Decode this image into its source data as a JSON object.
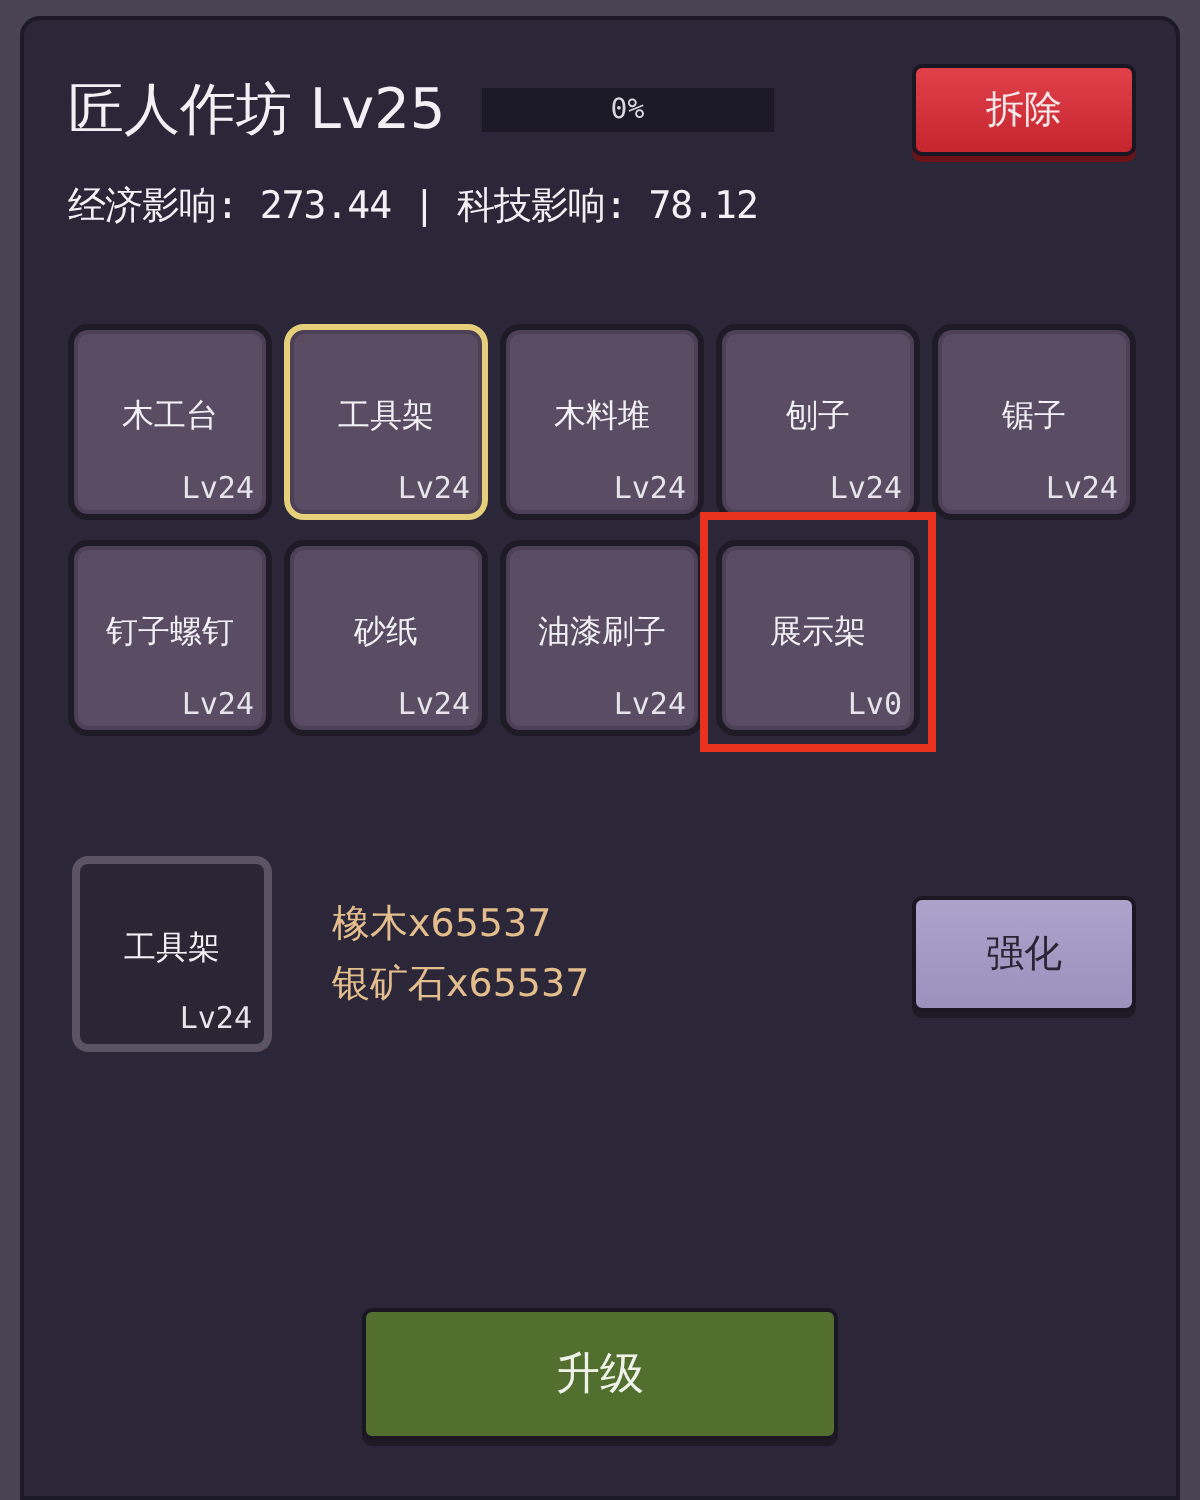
{
  "header": {
    "title": "匠人作坊",
    "level": "Lv25",
    "progress": {
      "level": 0,
      "reading": "0%"
    },
    "demolish_button": "拆除"
  },
  "stats": "经济影响: 273.44 | 科技影响: 78.12",
  "tools": [
    {
      "name": "木工台",
      "level": "Lv24",
      "selected": false,
      "highlighted": false
    },
    {
      "name": "工具架",
      "level": "Lv24",
      "selected": true,
      "highlighted": false
    },
    {
      "name": "木料堆",
      "level": "Lv24",
      "selected": false,
      "highlighted": false
    },
    {
      "name": "刨子",
      "level": "Lv24",
      "selected": false,
      "highlighted": false
    },
    {
      "name": "锯子",
      "level": "Lv24",
      "selected": false,
      "highlighted": false
    },
    {
      "name": "钉子螺钉",
      "level": "Lv24",
      "selected": false,
      "highlighted": false
    },
    {
      "name": "砂纸",
      "level": "Lv24",
      "selected": false,
      "highlighted": false
    },
    {
      "name": "油漆刷子",
      "level": "Lv24",
      "selected": false,
      "highlighted": false
    },
    {
      "name": "展示架",
      "level": "Lv0",
      "selected": false,
      "highlighted": true
    }
  ],
  "detail": {
    "name": "工具架",
    "level": "Lv24",
    "costs": [
      "橡木x65537",
      "银矿石x65537"
    ],
    "enhance_button": "强化"
  },
  "upgrade_button": "升级"
}
